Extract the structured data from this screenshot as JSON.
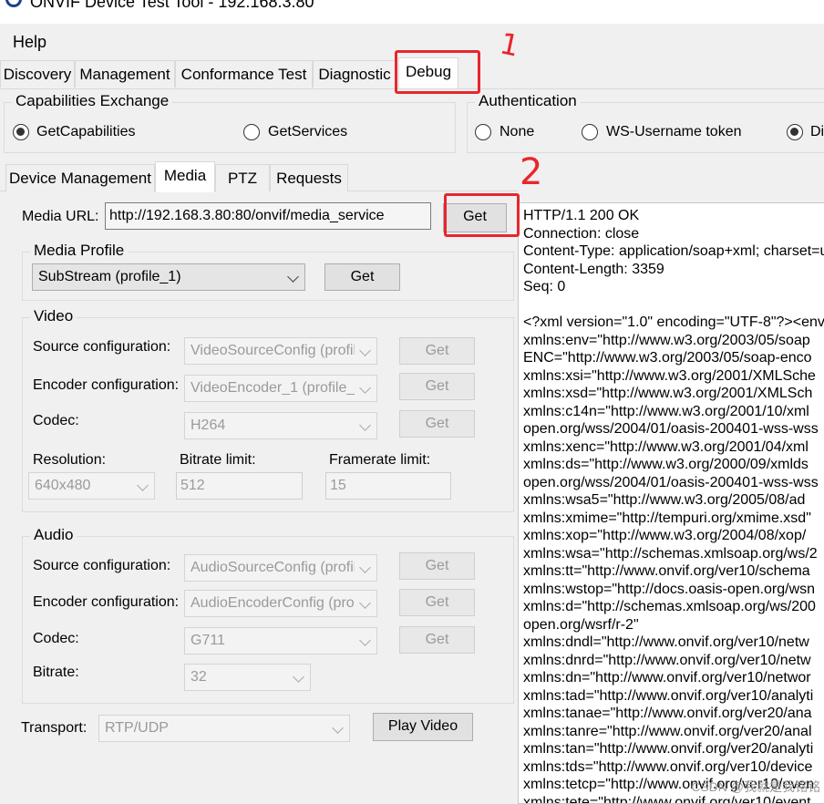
{
  "window": {
    "title": "ONVIF Device Test Tool - 192.168.3.80"
  },
  "menu": {
    "help": "Help"
  },
  "main_tabs": [
    "Discovery",
    "Management",
    "Conformance Test",
    "Diagnostic",
    "Debug"
  ],
  "capabilities": {
    "legend": "Capabilities Exchange",
    "options": [
      "GetCapabilities",
      "GetServices"
    ],
    "selected": "GetCapabilities"
  },
  "authentication": {
    "legend": "Authentication",
    "options": [
      "None",
      "WS-Username token",
      "Di"
    ],
    "selected": "Di"
  },
  "sub_tabs": [
    "Device Management",
    "Media",
    "PTZ",
    "Requests"
  ],
  "media_url": {
    "label": "Media URL:",
    "value": "http://192.168.3.80:80/onvif/media_service",
    "get": "Get"
  },
  "media_profile": {
    "legend": "Media Profile",
    "selected": "SubStream (profile_1)",
    "get": "Get"
  },
  "video": {
    "legend": "Video",
    "source_label": "Source configuration:",
    "source_value": "VideoSourceConfig (profil",
    "encoder_label": "Encoder configuration:",
    "encoder_value": "VideoEncoder_1 (profile_",
    "codec_label": "Codec:",
    "codec_value": "H264",
    "get": "Get",
    "resolution_label": "Resolution:",
    "resolution_value": "640x480",
    "bitrate_label": "Bitrate limit:",
    "bitrate_value": "512",
    "framerate_label": "Framerate limit:",
    "framerate_value": "15"
  },
  "audio": {
    "legend": "Audio",
    "source_label": "Source configuration:",
    "source_value": "AudioSourceConfig (profil",
    "encoder_label": "Encoder configuration:",
    "encoder_value": "AudioEncoderConfig (pro",
    "codec_label": "Codec:",
    "codec_value": "G711",
    "get": "Get",
    "bitrate_label": "Bitrate:",
    "bitrate_value": "32"
  },
  "transport": {
    "label": "Transport:",
    "value": "RTP/UDP",
    "play": "Play Video"
  },
  "response_lines": [
    "HTTP/1.1 200 OK",
    "Connection: close",
    "Content-Type: application/soap+xml; charset=u",
    "Content-Length: 3359",
    "Seq: 0",
    "",
    "<?xml version=\"1.0\" encoding=\"UTF-8\"?><env",
    "xmlns:env=\"http://www.w3.org/2003/05/soap",
    "ENC=\"http://www.w3.org/2003/05/soap-enco",
    "xmlns:xsi=\"http://www.w3.org/2001/XMLSche",
    "xmlns:xsd=\"http://www.w3.org/2001/XMLSch",
    "xmlns:c14n=\"http://www.w3.org/2001/10/xml",
    "open.org/wss/2004/01/oasis-200401-wss-wss",
    "xmlns:xenc=\"http://www.w3.org/2001/04/xml",
    "xmlns:ds=\"http://www.w3.org/2000/09/xmlds",
    "open.org/wss/2004/01/oasis-200401-wss-wss",
    "xmlns:wsa5=\"http://www.w3.org/2005/08/ad",
    "xmlns:xmime=\"http://tempuri.org/xmime.xsd\"",
    "xmlns:xop=\"http://www.w3.org/2004/08/xop/",
    "xmlns:wsa=\"http://schemas.xmlsoap.org/ws/2",
    "xmlns:tt=\"http://www.onvif.org/ver10/schema",
    "xmlns:wstop=\"http://docs.oasis-open.org/wsn",
    "xmlns:d=\"http://schemas.xmlsoap.org/ws/200",
    "open.org/wsrf/r-2\"",
    "xmlns:dndl=\"http://www.onvif.org/ver10/netw",
    "xmlns:dnrd=\"http://www.onvif.org/ver10/netw",
    "xmlns:dn=\"http://www.onvif.org/ver10/networ",
    "xmlns:tad=\"http://www.onvif.org/ver10/analyti",
    "xmlns:tanae=\"http://www.onvif.org/ver20/ana",
    "xmlns:tanre=\"http://www.onvif.org/ver20/anal",
    "xmlns:tan=\"http://www.onvif.org/ver20/analyti",
    "xmlns:tds=\"http://www.onvif.org/ver10/device",
    "xmlns:tetcp=\"http://www.onvif.org/ver10/even",
    "xmlns:tete=\"http://www.onvif.org/ver10/event"
  ],
  "annotations": {
    "one": "1",
    "two": "2"
  },
  "watermark": "CSDN @我就是我铭铭"
}
